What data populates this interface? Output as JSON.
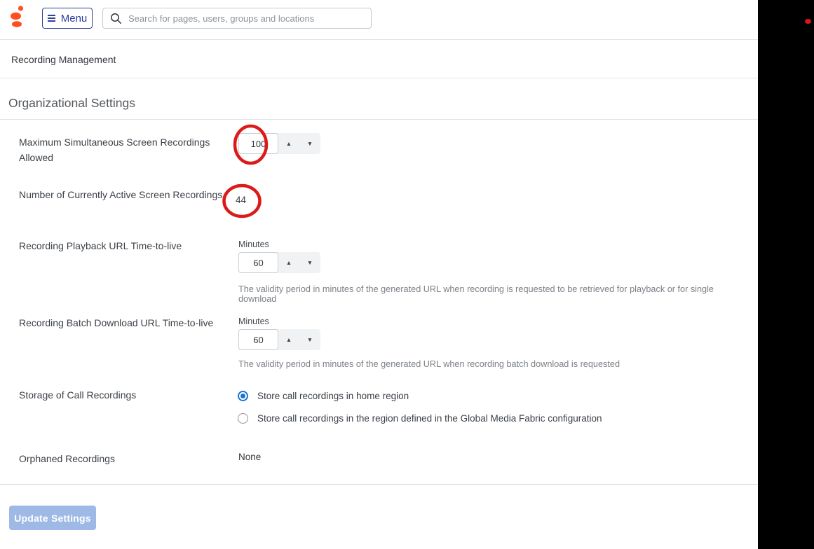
{
  "colors": {
    "brand_orange": "#ff4f1f",
    "menu_blue": "#2c3f9b",
    "radio_blue": "#1b74d3",
    "annotation_red": "#dd1a1a",
    "button_blue": "#9eb9e6",
    "strip_dot_red": "#dd1418"
  },
  "icons": {
    "spinner_up": "▲",
    "spinner_down": "▼"
  },
  "header": {
    "menu_label": "Menu",
    "search_placeholder": "Search for pages, users, groups and locations"
  },
  "breadcrumb": {
    "title": "Recording Management"
  },
  "page": {
    "heading": "Organizational Settings"
  },
  "fields": {
    "max_simultaneous": {
      "label": "Maximum Simultaneous Screen Recordings Allowed",
      "value": "100"
    },
    "active_recordings": {
      "label": "Number of Currently Active Screen Recordings",
      "value": "44"
    },
    "playback_ttl": {
      "label": "Recording Playback URL Time-to-live",
      "unit": "Minutes",
      "value": "60",
      "help": "The validity period in minutes of the generated URL when recording is requested to be retrieved for playback or for single download"
    },
    "batch_ttl": {
      "label": "Recording Batch Download URL Time-to-live",
      "unit": "Minutes",
      "value": "60",
      "help": "The validity period in minutes of the generated URL when recording batch download is requested"
    },
    "storage": {
      "label": "Storage of Call Recordings",
      "options": [
        {
          "label": "Store call recordings in home region",
          "selected": true
        },
        {
          "label": "Store call recordings in the region defined in the Global Media Fabric configuration",
          "selected": false
        }
      ]
    },
    "orphaned": {
      "label": "Orphaned Recordings",
      "value": "None"
    }
  },
  "footer": {
    "update_button_label": "Update Settings"
  }
}
